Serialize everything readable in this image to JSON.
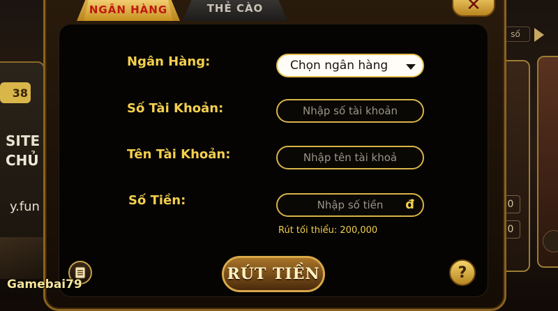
{
  "background": {
    "left_badge": "38",
    "left_text_1": "SITE",
    "left_text_2": "CHỦ",
    "left_text_3": "y.fun",
    "right_search": "số",
    "right_num_1": "0",
    "right_num_2": "0"
  },
  "tabs": {
    "bank": "NGÂN HÀNG",
    "card": "THẺ CÀO"
  },
  "close_label": "✕",
  "form": {
    "bank_label": "Ngân Hàng:",
    "bank_select_value": "Chọn ngân hàng",
    "account_number_label": "Số Tài Khoản:",
    "account_number_placeholder": "Nhập số tài khoản",
    "account_name_label": "Tên Tài Khoản:",
    "account_name_placeholder": "Nhập tên tài khoả",
    "amount_label": "Số Tiền:",
    "amount_placeholder": "Nhập số tiền",
    "currency_symbol": "đ",
    "min_note": "Rút tối thiểu: 200,000"
  },
  "buttons": {
    "submit": "RÚT TIỀN",
    "help": "?"
  },
  "watermark": "Gamebai79",
  "colors": {
    "gold": "#f4cf4f",
    "active_tab_text": "#c0170f",
    "panel_bg": "#050403"
  }
}
